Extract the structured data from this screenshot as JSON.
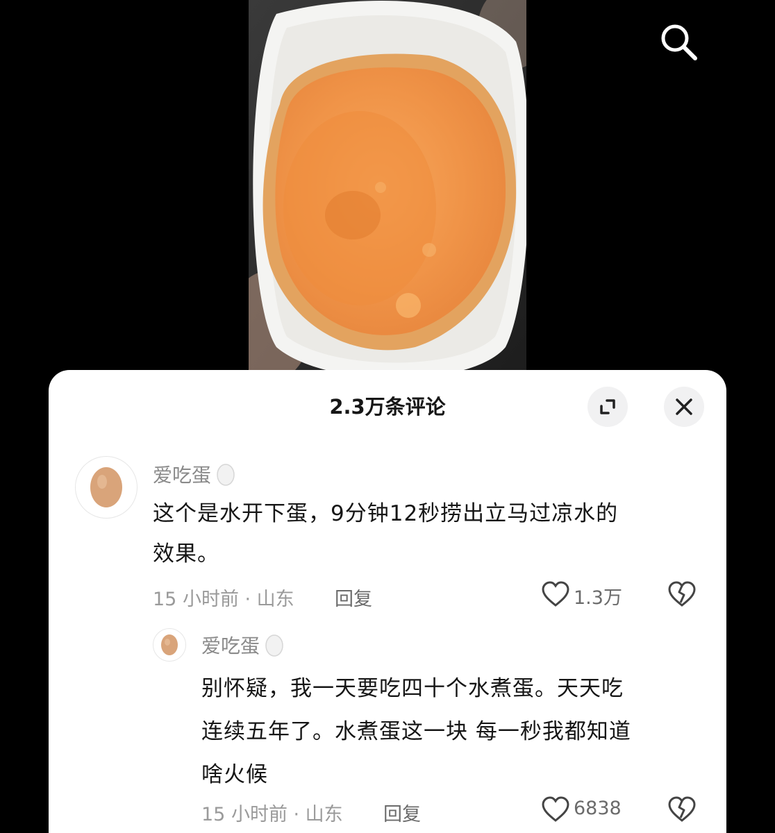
{
  "top": {
    "search_icon": "search-icon"
  },
  "sheet": {
    "title": "2.3万条评论",
    "expand_icon": "expand-icon",
    "close_icon": "close-icon"
  },
  "comments": [
    {
      "username": "爱吃蛋",
      "name_emoji": "egg",
      "text_line1": "这个是水开下蛋，9分钟12秒捞出立马过凉水的",
      "text_line2": "效果。",
      "meta": "15 小时前 · 山东",
      "reply": "回复",
      "likes": "1.3万"
    },
    {
      "username": "爱吃蛋",
      "name_emoji": "egg",
      "text_line1": "别怀疑，我一天要吃四十个水煮蛋。天天吃",
      "text_line2": "连续五年了。水煮蛋这一块 每一秒我都知道",
      "text_line3": "啥火候",
      "meta": "15 小时前 · 山东",
      "reply": "回复",
      "likes": "6838"
    }
  ],
  "colors": {
    "background": "#000000",
    "sheet": "#ffffff",
    "yolk": "#f39a4a",
    "egg_white": "#f4f4f2"
  }
}
